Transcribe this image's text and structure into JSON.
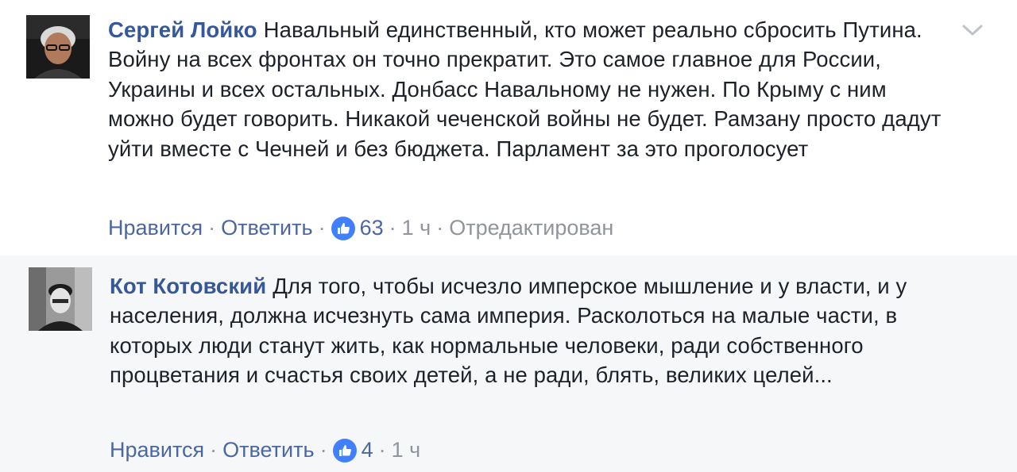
{
  "comments": [
    {
      "author": "Сергей Лойко",
      "text": "Навальный единственный, кто может реально сбросить Путина. Войну на всех фронтах он точно прекратит. Это самое главное для России, Украины и всех остальных. Донбасс Навальному не нужен. По Крыму с ним можно будет говорить. Никакой чеченской войны не будет. Рамзану просто дадут уйти вместе с Чечней и без бюджета. Парламент за это проголосует",
      "like_label": "Нравится",
      "reply_label": "Ответить",
      "reactions_count": "63",
      "time": "1 ч",
      "edited_label": "Отредактирован",
      "separator": "·"
    },
    {
      "author": "Кот Котовский",
      "text": "Для того, чтобы исчезло имперское мышление и у власти, и у населения, должна исчезнуть сама империя. Расколоться на малые части, в которых люди станут жить, как нормальные человеки, ради собственного процветания и счастья своих детей, а не ради, блять, великих целей...",
      "like_label": "Нравится",
      "reply_label": "Ответить",
      "reactions_count": "4",
      "time": "1 ч",
      "separator": "·"
    }
  ],
  "icons": {
    "menu": "chevron-down-icon",
    "reaction": "thumbs-up-icon"
  },
  "colors": {
    "author": "#365899",
    "link": "#4b67a1",
    "meta": "#90949c",
    "like_badge": "#4080ff",
    "reply_bg": "#f6f7f9"
  }
}
